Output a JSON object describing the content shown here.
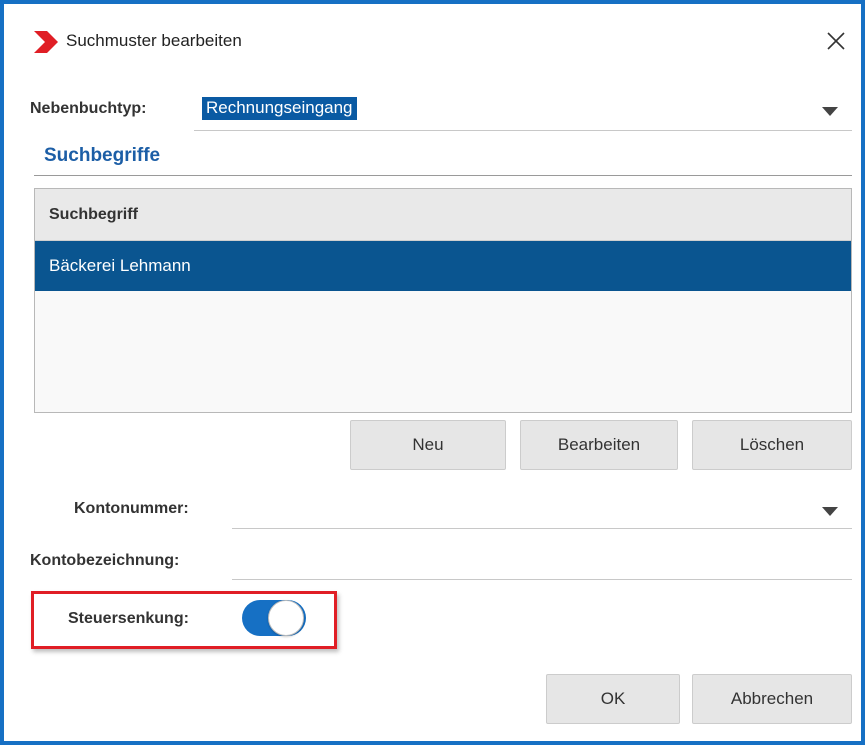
{
  "window": {
    "title": "Suchmuster bearbeiten",
    "logo_icon": "red-chevron-logo",
    "accent_color": "#1670c4"
  },
  "nebenbuchtyp": {
    "label": "Nebenbuchtyp:",
    "value": "Rechnungseingang"
  },
  "suchbegriffe": {
    "section_title": "Suchbegriffe",
    "column_header": "Suchbegriff",
    "rows": [
      "Bäckerei Lehmann"
    ],
    "selected_row": 0
  },
  "list_buttons": {
    "new": "Neu",
    "edit": "Bearbeiten",
    "delete": "Löschen"
  },
  "kontonummer": {
    "label": "Kontonummer:",
    "value": ""
  },
  "kontobezeichnung": {
    "label": "Kontobezeichnung:",
    "value": ""
  },
  "steuersenkung": {
    "label": "Steuersenkung:",
    "enabled": true,
    "highlight_color": "#e01e25"
  },
  "footer": {
    "ok": "OK",
    "cancel": "Abbrechen"
  }
}
